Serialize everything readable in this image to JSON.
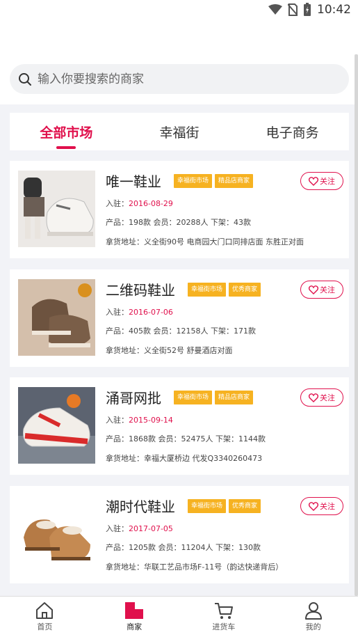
{
  "status": {
    "time": "10:42"
  },
  "search": {
    "placeholder": "输入你要搜索的商家"
  },
  "tabs": [
    {
      "label": "全部市场",
      "active": true
    },
    {
      "label": "幸福街",
      "active": false
    },
    {
      "label": "电子商务",
      "active": false
    }
  ],
  "shops": [
    {
      "name": "唯一鞋业",
      "tags": [
        "幸福街市场",
        "精品店商家"
      ],
      "follow": "关注",
      "joined_label": "入驻：",
      "joined": "2016-08-29",
      "stats": "产品：198款  会员：20288人  下架：43款",
      "address": "拿货地址：义全街90号 电商园大门口同排店面 东胜正对面"
    },
    {
      "name": "二维码鞋业",
      "tags": [
        "幸福街市场",
        "优秀商家"
      ],
      "follow": "关注",
      "joined_label": "入驻：",
      "joined": "2016-07-06",
      "stats": "产品：405款  会员：12158人  下架：171款",
      "address": "拿货地址：义全街52号 舒曼酒店对面"
    },
    {
      "name": "涌哥网批",
      "tags": [
        "幸福街市场",
        "精品店商家"
      ],
      "follow": "关注",
      "joined_label": "入驻：",
      "joined": "2015-09-14",
      "stats": "产品：1868款  会员：52475人  下架：1144款",
      "address": "拿货地址：幸福大厦桥边 代发Q3340260473"
    },
    {
      "name": "潮时代鞋业",
      "tags": [
        "幸福街市场",
        "优秀商家"
      ],
      "follow": "关注",
      "joined_label": "入驻：",
      "joined": "2017-07-05",
      "stats": "产品：1205款  会员：11204人  下架：130款",
      "address": "拿货地址：华联工艺品市场F-11号（韵达快递背后）"
    }
  ],
  "nav": [
    {
      "label": "首页",
      "icon": "home-icon",
      "active": false
    },
    {
      "label": "商家",
      "icon": "store-icon",
      "active": true
    },
    {
      "label": "进货车",
      "icon": "cart-icon",
      "active": false
    },
    {
      "label": "我的",
      "icon": "user-icon",
      "active": false
    }
  ],
  "colors": {
    "accent": "#e0104c",
    "tag": "#f6b221"
  }
}
